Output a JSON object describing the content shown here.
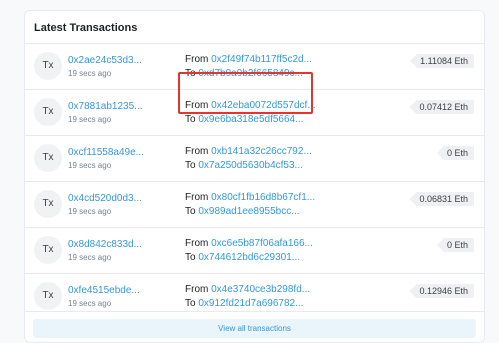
{
  "header": {
    "title": "Latest Transactions"
  },
  "transactions": [
    {
      "icon": "Tx",
      "hash": "0x2ae24c53d3...",
      "age": "19 secs ago",
      "from_label": "From",
      "from": "0x2f49f74b117ff5c2d...",
      "to_label": "To",
      "to": "0xd7b9a9b2f665849c...",
      "amount": "1.11084 Eth"
    },
    {
      "icon": "Tx",
      "hash": "0x7881ab1235...",
      "age": "19 secs ago",
      "from_label": "From",
      "from": "0x42eba0072d557dcf...",
      "to_label": "To",
      "to": "0x9e6ba318e5df5664...",
      "amount": "0.07412 Eth"
    },
    {
      "icon": "Tx",
      "hash": "0xcf11558a49e...",
      "age": "19 secs ago",
      "from_label": "From",
      "from": "0xb141a32c26cc792...",
      "to_label": "To",
      "to": "0x7a250d5630b4cf53...",
      "amount": "0 Eth"
    },
    {
      "icon": "Tx",
      "hash": "0x4cd520d0d3...",
      "age": "19 secs ago",
      "from_label": "From",
      "from": "0x80cf1fb16d8b67cf1...",
      "to_label": "To",
      "to": "0x989ad1ee8955bcc...",
      "amount": "0.06831 Eth"
    },
    {
      "icon": "Tx",
      "hash": "0x8d842c833d...",
      "age": "19 secs ago",
      "from_label": "From",
      "from": "0xc6e5b87f06afa166...",
      "to_label": "To",
      "to": "0x744612bd6c29301...",
      "amount": "0 Eth"
    },
    {
      "icon": "Tx",
      "hash": "0xfe4515ebde...",
      "age": "19 secs ago",
      "from_label": "From",
      "from": "0x4e3740ce3b298fd...",
      "to_label": "To",
      "to": "0x912fd21d7a696782...",
      "amount": "0.12946 Eth"
    }
  ],
  "footer": {
    "view_all_label": "View all transactions"
  },
  "colors": {
    "link": "#3498db",
    "highlight": "#e3342f"
  }
}
